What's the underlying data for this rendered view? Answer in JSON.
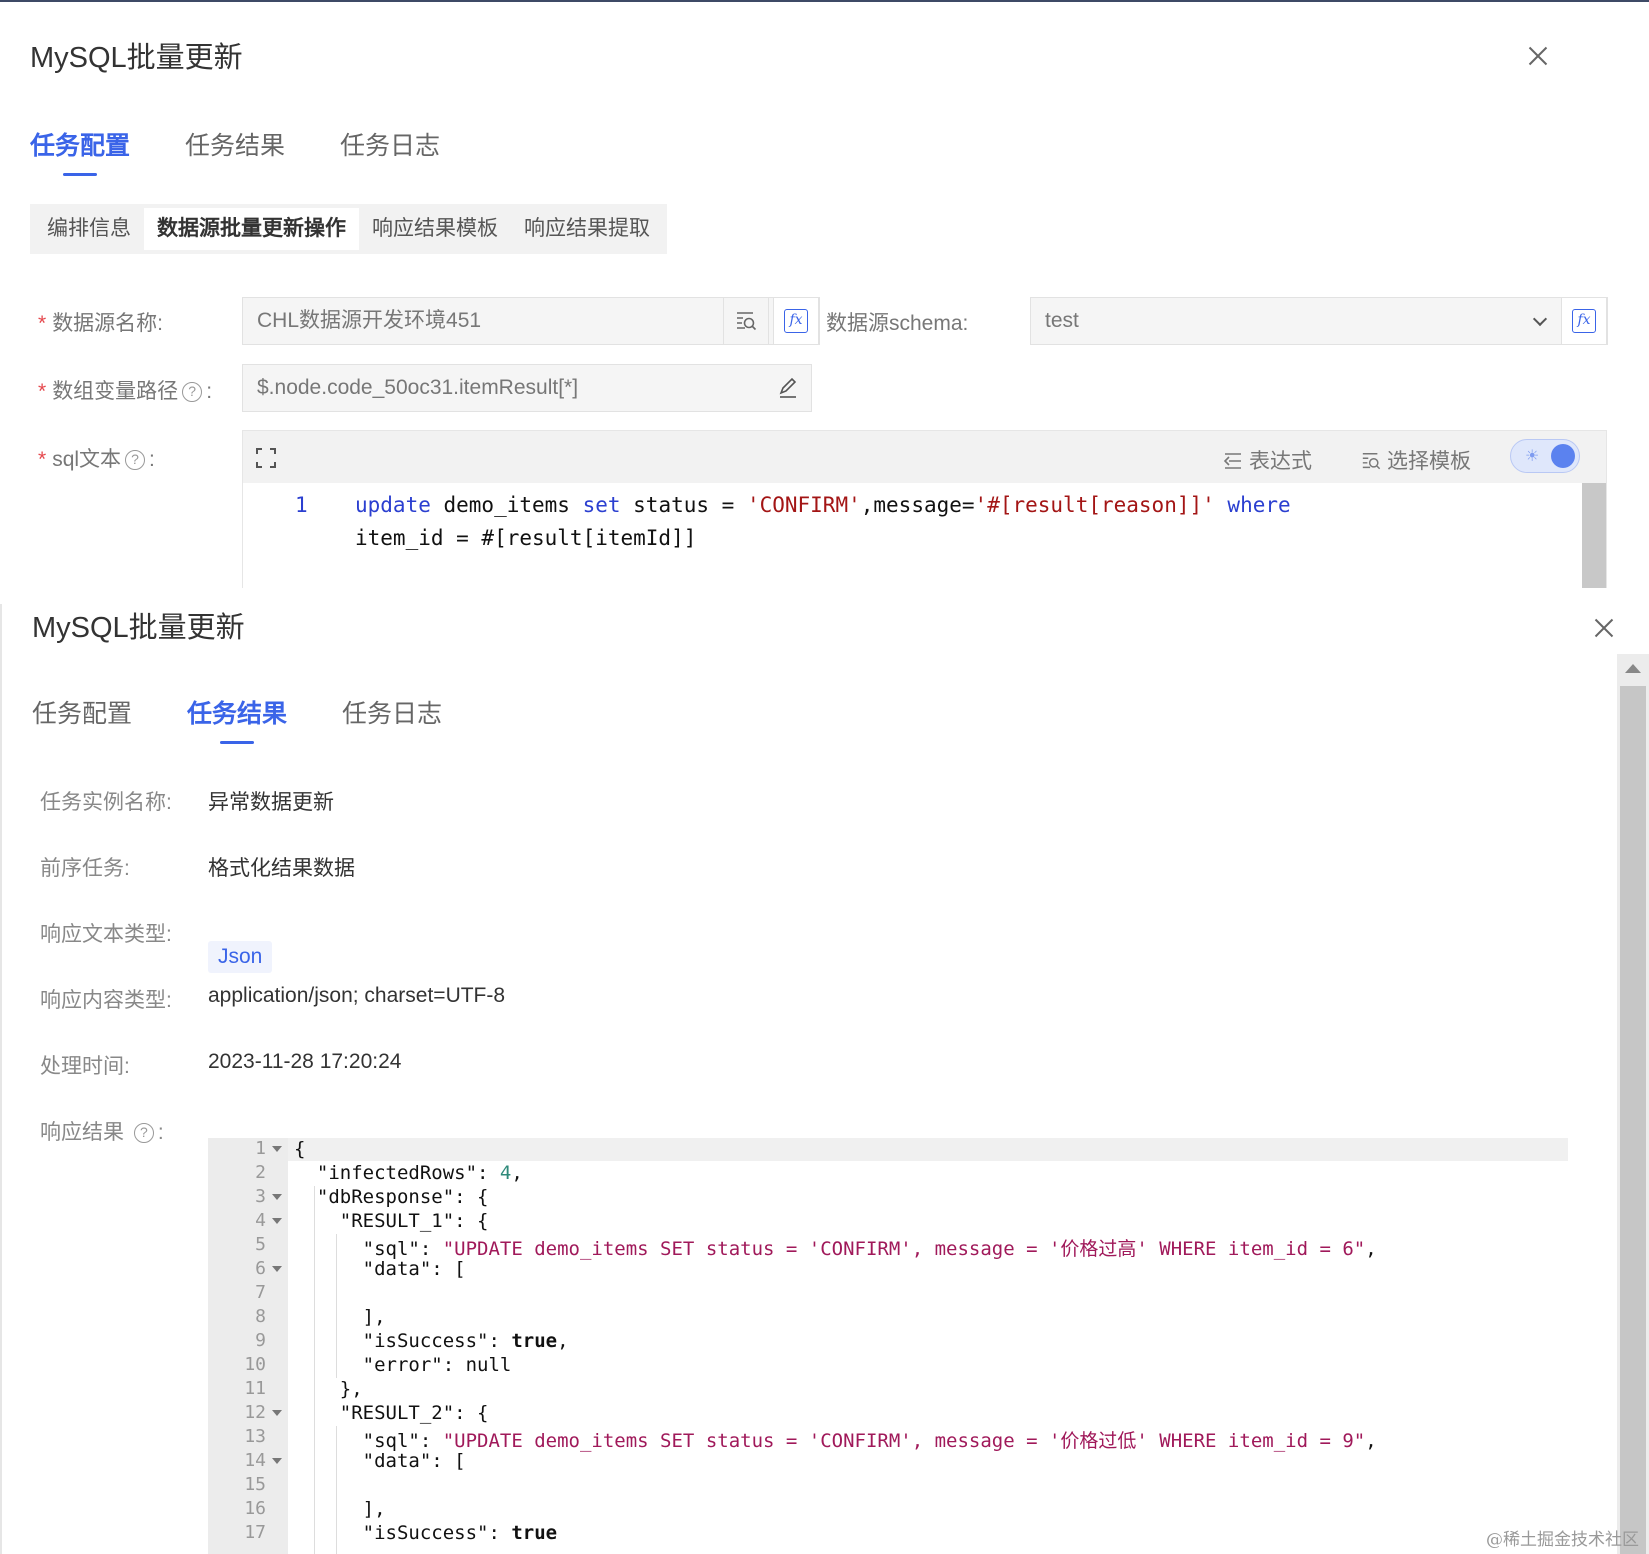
{
  "panel1": {
    "title": "MySQL批量更新",
    "tabs": [
      "任务配置",
      "任务结果",
      "任务日志"
    ],
    "subtabs": [
      "编排信息",
      "数据源批量更新操作",
      "响应结果模板",
      "响应结果提取"
    ],
    "datasource_label": "数据源名称:",
    "datasource_value": "CHL数据源开发环境451",
    "schema_label": "数据源schema:",
    "schema_value": "test",
    "array_path_label": "数组变量路径",
    "array_path_value": "$.node.code_50oc31.itemResult[*]",
    "sql_label": "sql文本",
    "toolbar_expression": "表达式",
    "toolbar_template": "选择模板",
    "sql_line_number": "1"
  },
  "panel2": {
    "title": "MySQL批量更新",
    "tabs": [
      "任务配置",
      "任务结果",
      "任务日志"
    ],
    "instance_label": "任务实例名称:",
    "instance_value": "异常数据更新",
    "pre_task_label": "前序任务:",
    "pre_task_value": "格式化结果数据",
    "resp_text_type_label": "响应文本类型:",
    "resp_text_type_value": "Json",
    "resp_content_type_label": "响应内容类型:",
    "resp_content_type_value": "application/json; charset=UTF-8",
    "process_time_label": "处理时间:",
    "process_time_value": "2023-11-28 17:20:24",
    "resp_result_label": "响应结果",
    "line_numbers": [
      "1",
      "2",
      "3",
      "4",
      "5",
      "6",
      "7",
      "8",
      "9",
      "10",
      "11",
      "12",
      "13",
      "14",
      "15",
      "16",
      "17"
    ]
  },
  "watermark": "@稀土掘金技术社区",
  "colors": {
    "accent": "#3a64e8",
    "required": "#e5484d",
    "string": "#a0195a",
    "number": "#2f8a7a"
  }
}
